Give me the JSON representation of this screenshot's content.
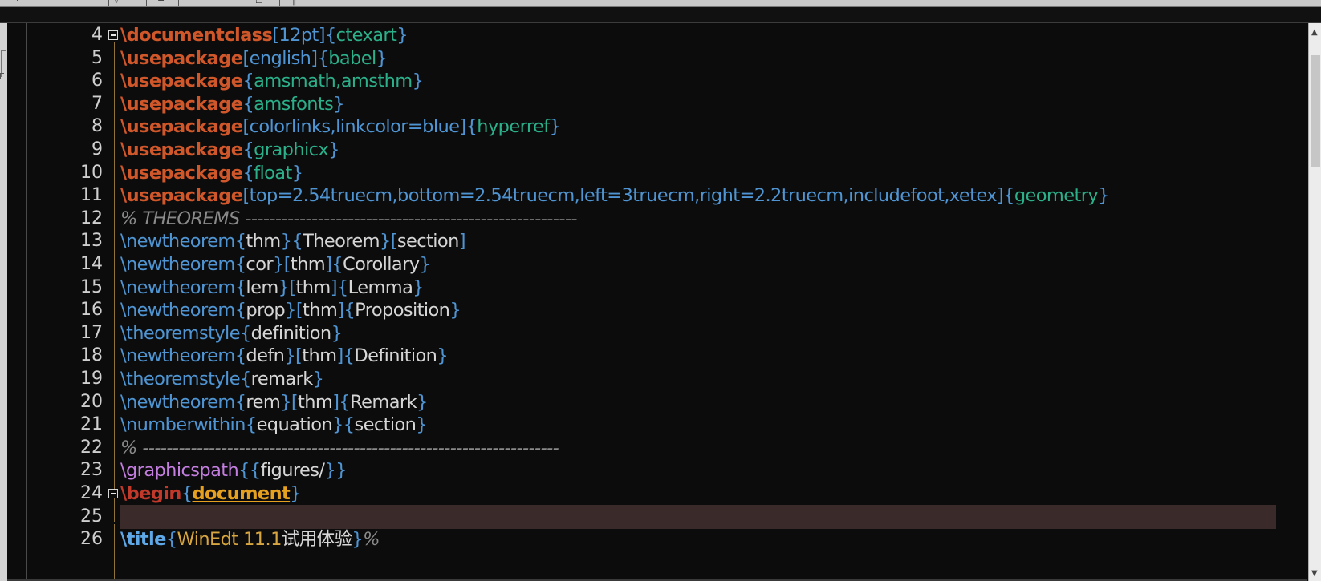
{
  "editor": {
    "app": "WinEdt",
    "highlighted_line": 24,
    "folded_lines": [
      4,
      24
    ],
    "lines": [
      {
        "no": "4",
        "tokens": [
          [
            "kw",
            "\\documentclass"
          ],
          [
            "opt",
            "[12pt]"
          ],
          [
            "br",
            "{"
          ],
          [
            "pkg",
            "ctexart"
          ],
          [
            "br",
            "}"
          ]
        ]
      },
      {
        "no": "5",
        "tokens": [
          [
            "kw",
            "\\usepackage"
          ],
          [
            "opt",
            "[english]"
          ],
          [
            "br",
            "{"
          ],
          [
            "pkg",
            "babel"
          ],
          [
            "br",
            "}"
          ]
        ]
      },
      {
        "no": "6",
        "tokens": [
          [
            "kw",
            "\\usepackage"
          ],
          [
            "br",
            "{"
          ],
          [
            "pkg",
            "amsmath,amsthm"
          ],
          [
            "br",
            "}"
          ]
        ]
      },
      {
        "no": "7",
        "tokens": [
          [
            "kw",
            "\\usepackage"
          ],
          [
            "br",
            "{"
          ],
          [
            "pkg",
            "amsfonts"
          ],
          [
            "br",
            "}"
          ]
        ]
      },
      {
        "no": "8",
        "tokens": [
          [
            "kw",
            "\\usepackage"
          ],
          [
            "opt",
            "[colorlinks,linkcolor=blue]"
          ],
          [
            "br",
            "{"
          ],
          [
            "pkg",
            "hyperref"
          ],
          [
            "br",
            "}"
          ]
        ]
      },
      {
        "no": "9",
        "tokens": [
          [
            "kw",
            "\\usepackage"
          ],
          [
            "br",
            "{"
          ],
          [
            "pkg",
            "graphicx"
          ],
          [
            "br",
            "}"
          ]
        ]
      },
      {
        "no": "10",
        "tokens": [
          [
            "kw",
            "\\usepackage"
          ],
          [
            "br",
            "{"
          ],
          [
            "pkg",
            "float"
          ],
          [
            "br",
            "}"
          ]
        ]
      },
      {
        "no": "11",
        "tokens": [
          [
            "kw",
            "\\usepackage"
          ],
          [
            "opt",
            "[top=2.54truecm,bottom=2.54truecm,left=3truecm,right=2.2truecm,includefoot,xetex]"
          ],
          [
            "br",
            "{"
          ],
          [
            "pkg",
            "geometry"
          ],
          [
            "br",
            "}"
          ]
        ]
      },
      {
        "no": "12",
        "tokens": [
          [
            "cmt",
            "% THEOREMS -------------------------------------------------------"
          ]
        ]
      },
      {
        "no": "13",
        "tokens": [
          [
            "cmd",
            "\\newtheorem"
          ],
          [
            "br",
            "{"
          ],
          [
            "txt",
            "thm"
          ],
          [
            "br",
            "}{"
          ],
          [
            "txt",
            "Theorem"
          ],
          [
            "br",
            "}["
          ],
          [
            "txt",
            "section"
          ],
          [
            "br",
            "]"
          ]
        ]
      },
      {
        "no": "14",
        "tokens": [
          [
            "cmd",
            "\\newtheorem"
          ],
          [
            "br",
            "{"
          ],
          [
            "txt",
            "cor"
          ],
          [
            "br",
            "}["
          ],
          [
            "txt",
            "thm"
          ],
          [
            "br",
            "]{"
          ],
          [
            "txt",
            "Corollary"
          ],
          [
            "br",
            "}"
          ]
        ]
      },
      {
        "no": "15",
        "tokens": [
          [
            "cmd",
            "\\newtheorem"
          ],
          [
            "br",
            "{"
          ],
          [
            "txt",
            "lem"
          ],
          [
            "br",
            "}["
          ],
          [
            "txt",
            "thm"
          ],
          [
            "br",
            "]{"
          ],
          [
            "txt",
            "Lemma"
          ],
          [
            "br",
            "}"
          ]
        ]
      },
      {
        "no": "16",
        "tokens": [
          [
            "cmd",
            "\\newtheorem"
          ],
          [
            "br",
            "{"
          ],
          [
            "txt",
            "prop"
          ],
          [
            "br",
            "}["
          ],
          [
            "txt",
            "thm"
          ],
          [
            "br",
            "]{"
          ],
          [
            "txt",
            "Proposition"
          ],
          [
            "br",
            "}"
          ]
        ]
      },
      {
        "no": "17",
        "tokens": [
          [
            "cmd",
            "\\theoremstyle"
          ],
          [
            "br",
            "{"
          ],
          [
            "txt",
            "definition"
          ],
          [
            "br",
            "}"
          ]
        ]
      },
      {
        "no": "18",
        "tokens": [
          [
            "cmd",
            "\\newtheorem"
          ],
          [
            "br",
            "{"
          ],
          [
            "txt",
            "defn"
          ],
          [
            "br",
            "}["
          ],
          [
            "txt",
            "thm"
          ],
          [
            "br",
            "]{"
          ],
          [
            "txt",
            "Definition"
          ],
          [
            "br",
            "}"
          ]
        ]
      },
      {
        "no": "19",
        "tokens": [
          [
            "cmd",
            "\\theoremstyle"
          ],
          [
            "br",
            "{"
          ],
          [
            "txt",
            "remark"
          ],
          [
            "br",
            "}"
          ]
        ]
      },
      {
        "no": "20",
        "tokens": [
          [
            "cmd",
            "\\newtheorem"
          ],
          [
            "br",
            "{"
          ],
          [
            "txt",
            "rem"
          ],
          [
            "br",
            "}["
          ],
          [
            "txt",
            "thm"
          ],
          [
            "br",
            "]{"
          ],
          [
            "txt",
            "Remark"
          ],
          [
            "br",
            "}"
          ]
        ]
      },
      {
        "no": "21",
        "tokens": [
          [
            "cmd",
            "\\numberwithin"
          ],
          [
            "br",
            "{"
          ],
          [
            "txt",
            "equation"
          ],
          [
            "br",
            "}{"
          ],
          [
            "txt",
            "section"
          ],
          [
            "br",
            "}"
          ]
        ]
      },
      {
        "no": "22",
        "tokens": [
          [
            "cmt",
            "% ---------------------------------------------------------------------"
          ]
        ]
      },
      {
        "no": "23",
        "tokens": [
          [
            "gp",
            "\\graphicspath"
          ],
          [
            "br",
            "{{"
          ],
          [
            "txt",
            "figures/"
          ],
          [
            "br",
            "}}"
          ]
        ]
      },
      {
        "no": "24",
        "tokens": [
          [
            "kwb",
            "\\begin"
          ],
          [
            "br",
            "{"
          ],
          [
            "env",
            "document"
          ],
          [
            "br",
            "}"
          ]
        ]
      },
      {
        "no": "25",
        "tokens": []
      },
      {
        "no": "26",
        "tokens": [
          [
            "cmdb",
            "\\title"
          ],
          [
            "br",
            "{"
          ],
          [
            "ttl",
            "WinEdt 11.1"
          ],
          [
            "cjk",
            "试用体验"
          ],
          [
            "br",
            "}"
          ],
          [
            "cmt",
            "%"
          ]
        ]
      }
    ]
  },
  "colors": {
    "background": "#0c0c0c",
    "keyword": "#d0572a",
    "command": "#4f95d3",
    "package": "#2bb08a",
    "comment": "#8a8a8a",
    "environment": "#e6a020",
    "highlight_row": "#3a2a2a"
  },
  "icons": {
    "fold": "minus-box-icon",
    "scroll_up": "chevron-up-icon",
    "scroll_down": "chevron-down-icon"
  }
}
